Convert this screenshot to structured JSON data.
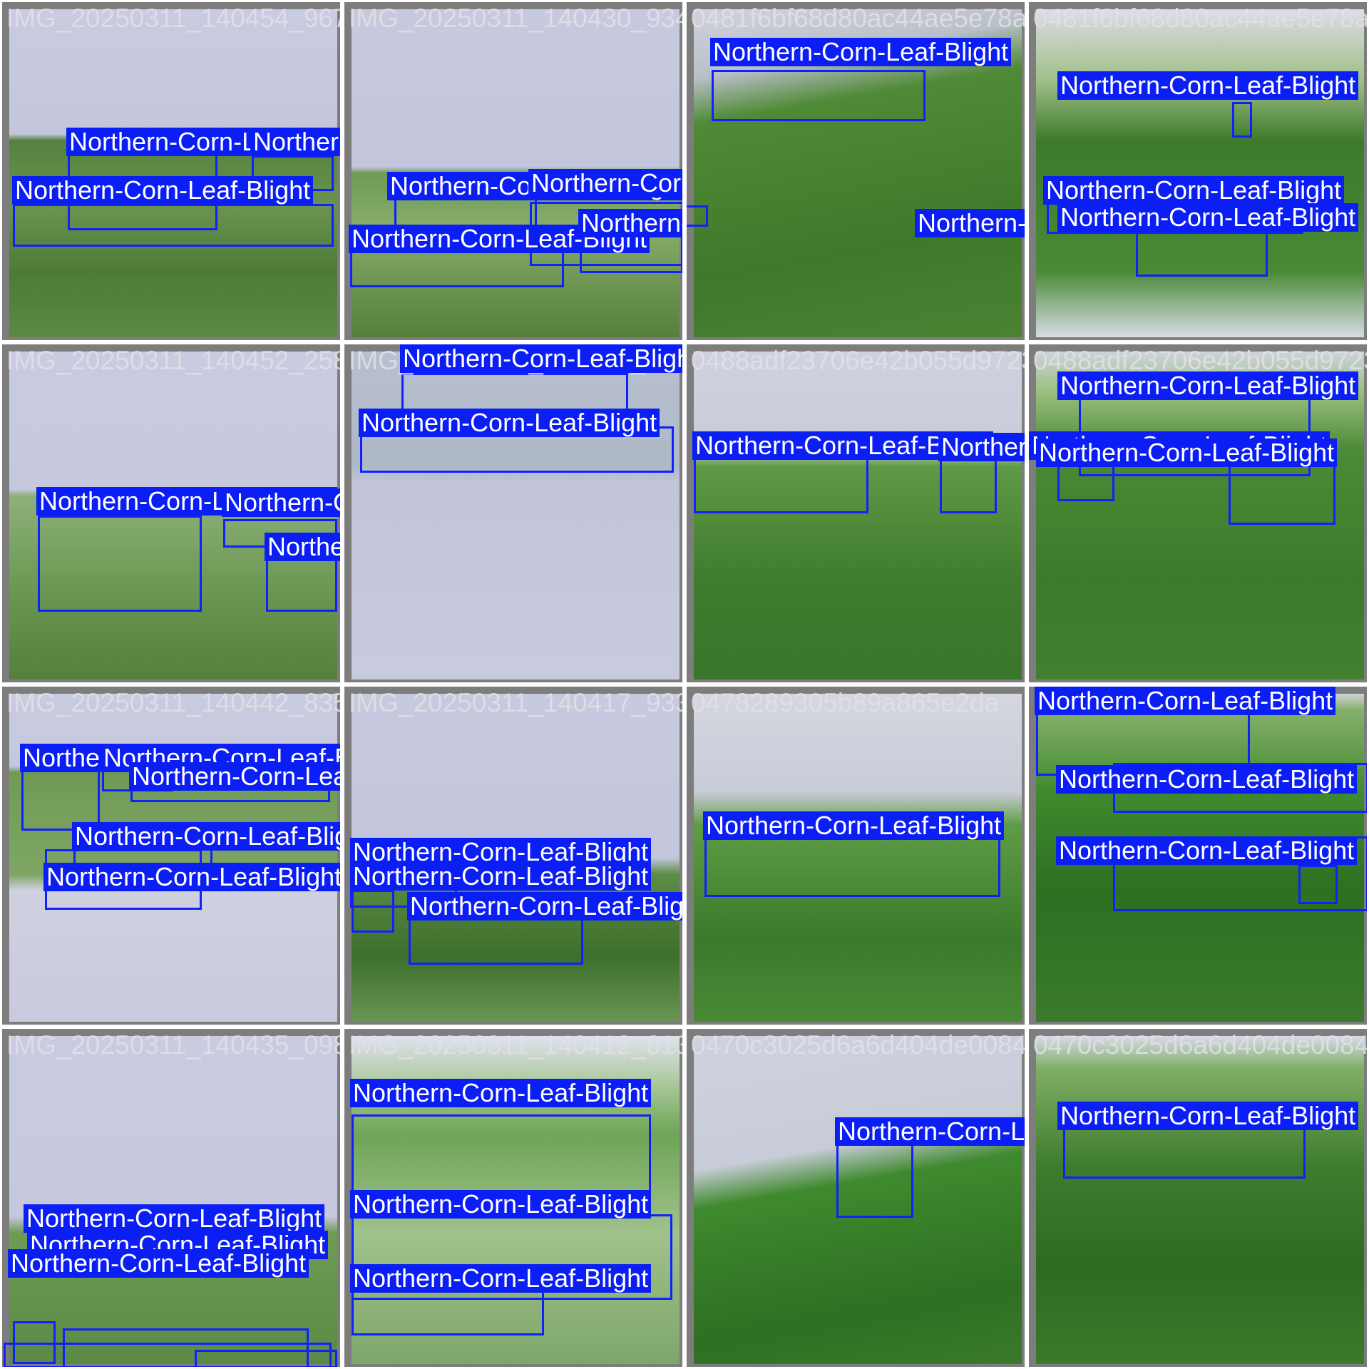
{
  "class_label": "Northern-Corn-Leaf-Blight",
  "box_color": "#1020ff",
  "label_bg": "#0a1ef5",
  "tiles": [
    {
      "filename": "IMG_20250311_140454_967.jpg"
    },
    {
      "filename": "IMG_20250311_140430_934.jpg"
    },
    {
      "filename": "0481f6bf68d80ac44ae5e78a0670e19f34fcb071272d"
    },
    {
      "filename": "0481f6bf68d80ac44ae5e78a0670e19f34fcb071272d"
    },
    {
      "filename": "IMG_20250311_140452_258.jpg"
    },
    {
      "filename": "IMG_20250311_140452_258.jpg"
    },
    {
      "filename": "0488adf23706e42b055d9723068a8f5"
    },
    {
      "filename": "0488adf23706e42b055d9723068a8f5"
    },
    {
      "filename": "IMG_20250311_140442_835.jpg"
    },
    {
      "filename": "IMG_20250311_140417_933.jpg"
    },
    {
      "filename": "0478289305b89a865e2da"
    },
    {
      "filename": ""
    },
    {
      "filename": "IMG_20250311_140435_098.jpg"
    },
    {
      "filename": "IMG_20250311_140412_813.jpg"
    },
    {
      "filename": "0470c3025d6a6d404de0084852cbf25dffaa3759644"
    },
    {
      "filename": "0470c3025d6a6d404de0084852cbf25dffaa3759644"
    }
  ]
}
